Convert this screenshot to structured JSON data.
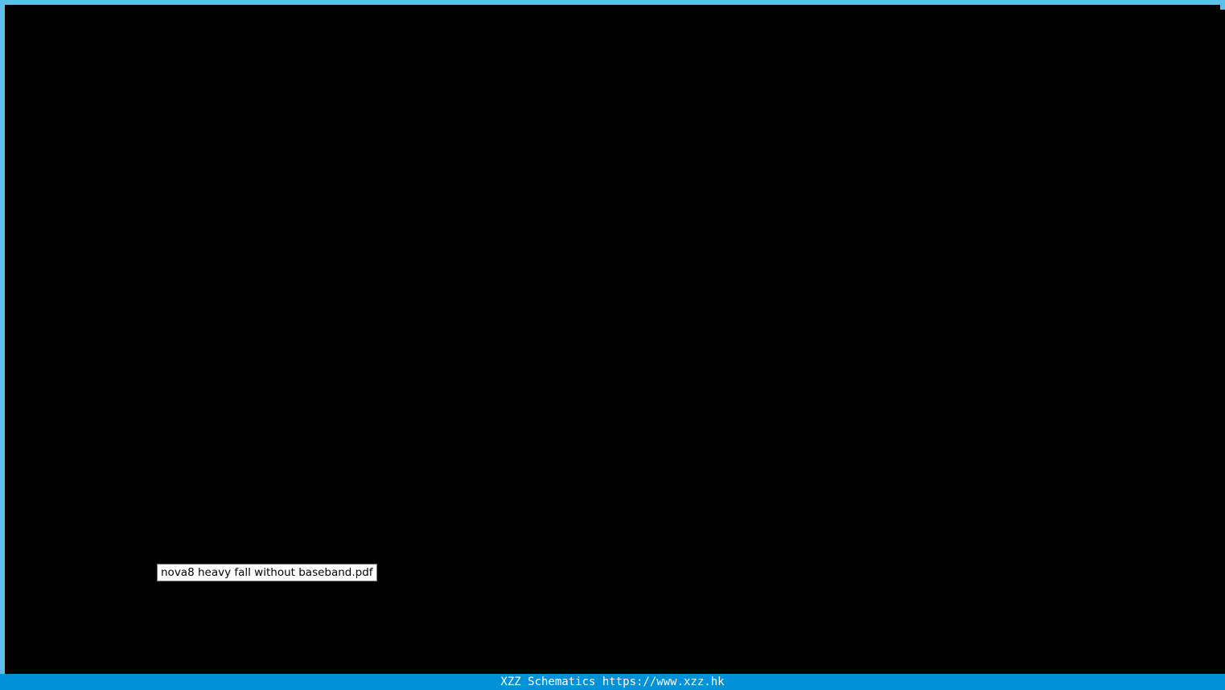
{
  "viewer": {
    "tooltip_text": "nova8 heavy fall without baseband.pdf"
  },
  "status_bar": {
    "text": "XZZ Schematics https://www.xzz.hk"
  },
  "colors": {
    "frame_border": "#5bc0e8",
    "canvas_background": "#000000",
    "status_bar_background": "#0091d8",
    "status_bar_text": "#ffffff"
  }
}
